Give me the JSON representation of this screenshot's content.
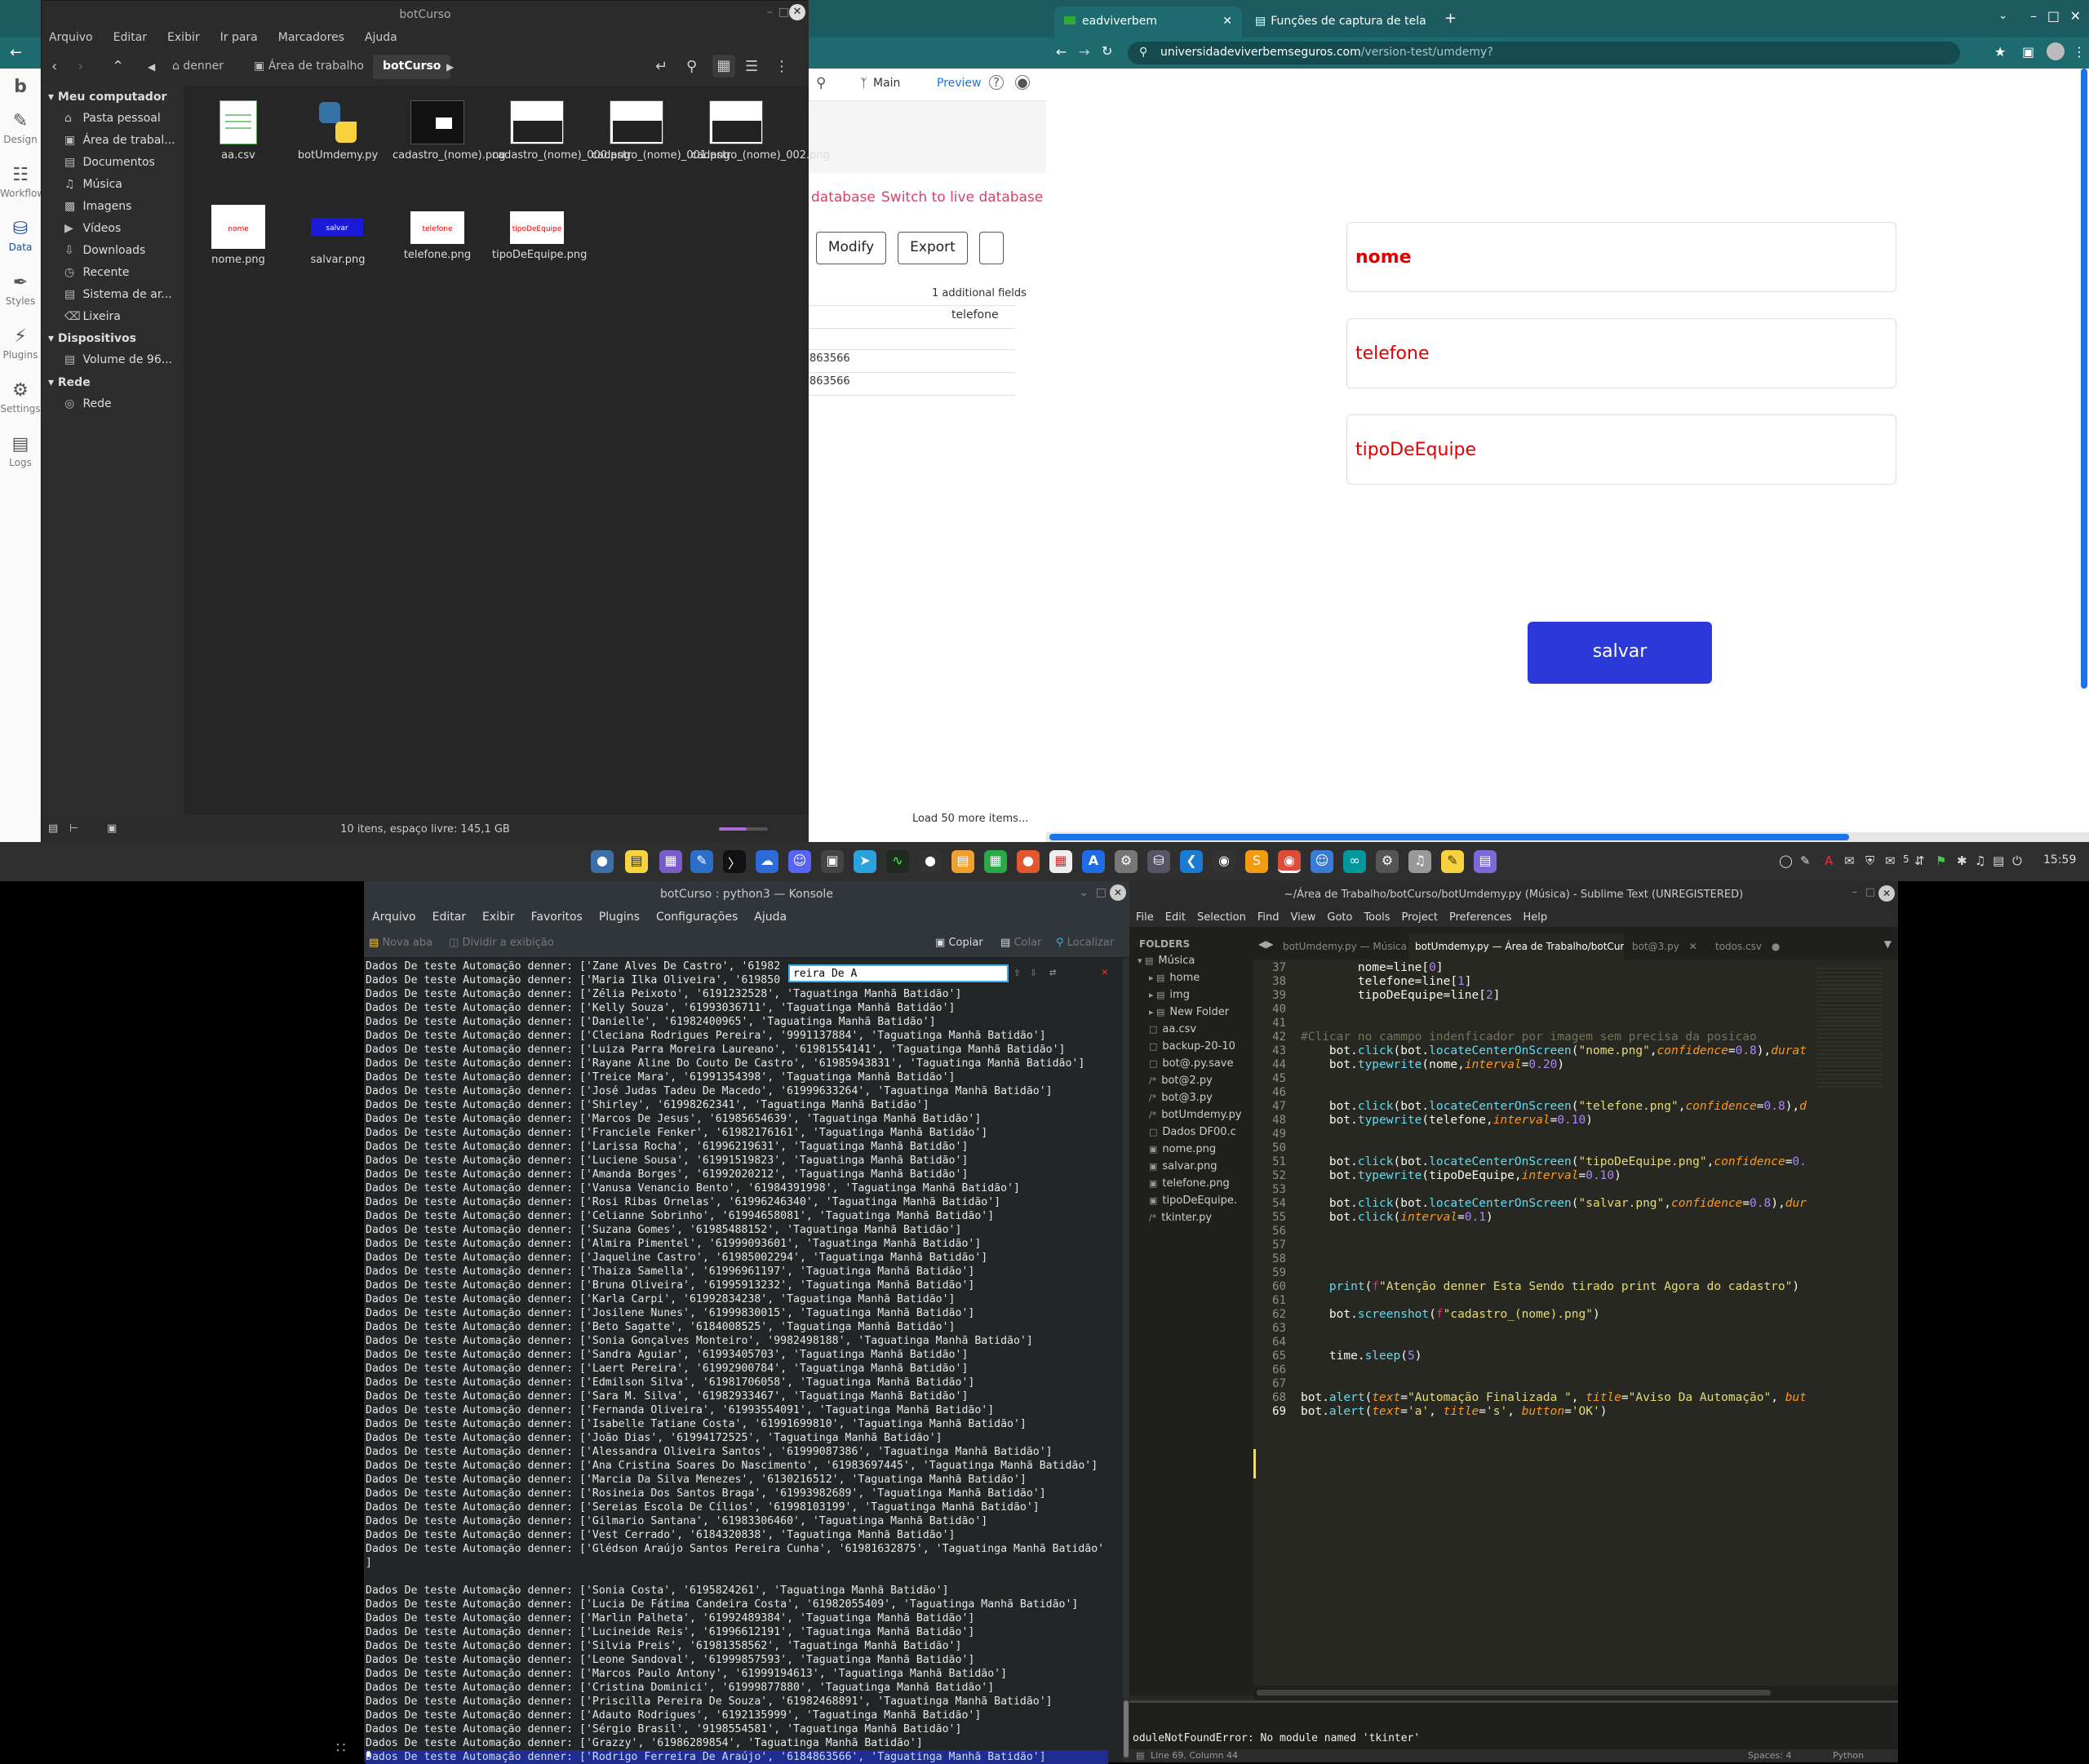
{
  "bg_chrome": {
    "strip": [
      {
        "label": "Design",
        "icon": "pencil-ruler-icon"
      },
      {
        "label": "Workflow",
        "icon": "workflow-icon"
      },
      {
        "label": "Data",
        "icon": "database-icon"
      },
      {
        "label": "Styles",
        "icon": "brush-icon"
      },
      {
        "label": "Plugins",
        "icon": "plug-icon"
      },
      {
        "label": "Settings",
        "icon": "gear-icon"
      },
      {
        "label": "Logs",
        "icon": "document-icon"
      }
    ],
    "main_tab": "Main",
    "preview": "Preview",
    "link_database": "database",
    "link_live": "Switch to live database",
    "btn_modify": "Modify",
    "btn_export": "Export",
    "additional_fields": "1 additional fields",
    "col_telefone": "telefone",
    "row1": "863566",
    "row2": "863566",
    "load_more": "Load 50 more items..."
  },
  "filemgr": {
    "title": "botCurso",
    "menu": [
      "Arquivo",
      "Editar",
      "Exibir",
      "Ir para",
      "Marcadores",
      "Ajuda"
    ],
    "crumbs": [
      "denner",
      "Área de trabalho",
      "botCurso"
    ],
    "sidebar": {
      "computer_head": "Meu computador",
      "computer": [
        "Pasta pessoal",
        "Área de trabal...",
        "Documentos",
        "Música",
        "Imagens",
        "Vídeos",
        "Downloads",
        "Recente",
        "Sistema de ar...",
        "Lixeira"
      ],
      "devices_head": "Dispositivos",
      "devices": [
        "Volume de 96..."
      ],
      "network_head": "Rede",
      "network": [
        "Rede"
      ]
    },
    "files": [
      {
        "name": "aa.csv"
      },
      {
        "name": "botUmdemy.py"
      },
      {
        "name": "cadastro_(nome).png"
      },
      {
        "name": "cadastro_(nome)_000.png"
      },
      {
        "name": "cadastro_(nome)_001.png"
      },
      {
        "name": "cadastro_(nome)_002.png"
      },
      {
        "name": "nome.png"
      },
      {
        "name": "salvar.png"
      },
      {
        "name": "telefone.png"
      },
      {
        "name": "tipoDeEquipe.png"
      }
    ],
    "thumb_text": {
      "nome": "nome",
      "salvar": "salvar",
      "telefone": "telefone",
      "tipo": "tipoDeEquipe"
    },
    "status": "10 itens, espaço livre: 145,1 GB"
  },
  "chrome": {
    "tabs": [
      "eadviverbem",
      "Funções de captura de tela"
    ],
    "url_host": "universidadeviverbemseguros.com",
    "url_path": "/version-test/umdemy?",
    "fields": [
      "nome",
      "telefone",
      "tipoDeEquipe"
    ],
    "save": "salvar"
  },
  "taskbar": {
    "clock": "15:59",
    "badge": "5"
  },
  "konsole": {
    "title": "botCurso : python3 — Konsole",
    "menu": [
      "Arquivo",
      "Editar",
      "Exibir",
      "Favoritos",
      "Plugins",
      "Configurações",
      "Ajuda"
    ],
    "toolbar_left": "Nova aba",
    "toolbar_split": "Dividir a exibição",
    "toolbar_copy": "Copiar",
    "toolbar_paste": "Colar",
    "toolbar_find": "Localizar",
    "search": "reira De A",
    "lines": [
      "Dados De teste Automação denner: ['Zane Alves De Castro', '61982",
      "Dados De teste Automação denner: ['Maria Ilka Oliveira', '619850",
      "Dados De teste Automação denner: ['Zélia Peixoto', '6191232528', 'Taguatinga Manhã Batidão']",
      "Dados De teste Automação denner: ['Kelly Souza', '61993036711', 'Taguatinga Manhã Batidão']",
      "Dados De teste Automação denner: ['Danielle', '61982400965', 'Taguatinga Manhã Batidão']",
      "Dados De teste Automação denner: ['Cleciana Rodrigues Pereira', '9991137884', 'Taguatinga Manhã Batidão']",
      "Dados De teste Automação denner: ['Luiza Parra Moreira Laureano', '61981554141', 'Taguatinga Manhã Batidão']",
      "Dados De teste Automação denner: ['Rayane Aline Do Couto De Castro', '61985943831', 'Taguatinga Manhã Batidão']",
      "Dados De teste Automação denner: ['Treice Mara', '61991354398', 'Taguatinga Manhã Batidão']",
      "Dados De teste Automação denner: ['José Judas Tadeu De Macedo', '61999633264', 'Taguatinga Manhã Batidão']",
      "Dados De teste Automação denner: ['Shirley', '61998262341', 'Taguatinga Manhã Batidão']",
      "Dados De teste Automação denner: ['Marcos De Jesus', '61985654639', 'Taguatinga Manhã Batidão']",
      "Dados De teste Automação denner: ['Franciele Fenker', '61982176161', 'Taguatinga Manhã Batidão']",
      "Dados De teste Automação denner: ['Larissa Rocha', '61996219631', 'Taguatinga Manhã Batidão']",
      "Dados De teste Automação denner: ['Luciene Sousa', '61991519823', 'Taguatinga Manhã Batidão']",
      "Dados De teste Automação denner: ['Amanda Borges', '61992020212', 'Taguatinga Manhã Batidão']",
      "Dados De teste Automação denner: ['Vanusa Venancio Bento', '61984391998', 'Taguatinga Manhã Batidão']",
      "Dados De teste Automação denner: ['Rosi Ribas Ornelas', '61996246340', 'Taguatinga Manhã Batidão']",
      "Dados De teste Automação denner: ['Celianne Sobrinho', '61994658081', 'Taguatinga Manhã Batidão']",
      "Dados De teste Automação denner: ['Suzana Gomes', '61985488152', 'Taguatinga Manhã Batidão']",
      "Dados De teste Automação denner: ['Almira Pimentel', '61999093601', 'Taguatinga Manhã Batidão']",
      "Dados De teste Automação denner: ['Jaqueline Castro', '61985002294', 'Taguatinga Manhã Batidão']",
      "Dados De teste Automação denner: ['Thaiza Samella', '61996961197', 'Taguatinga Manhã Batidão']",
      "Dados De teste Automação denner: ['Bruna Oliveira', '61995913232', 'Taguatinga Manhã Batidão']",
      "Dados De teste Automação denner: ['Karla Carpi', '61992834238', 'Taguatinga Manhã Batidão']",
      "Dados De teste Automação denner: ['Josilene Nunes', '61999830015', 'Taguatinga Manhã Batidão']",
      "Dados De teste Automação denner: ['Beto Sagatte', '6184008525', 'Taguatinga Manhã Batidão']",
      "Dados De teste Automação denner: ['Sonia Gonçalves Monteiro', '9982498188', 'Taguatinga Manhã Batidão']",
      "Dados De teste Automação denner: ['Sandra Aguiar', '61993405703', 'Taguatinga Manhã Batidão']",
      "Dados De teste Automação denner: ['Laert Pereira', '61992900784', 'Taguatinga Manhã Batidão']",
      "Dados De teste Automação denner: ['Edmilson Silva', '61981706058', 'Taguatinga Manhã Batidão']",
      "Dados De teste Automação denner: ['Sara M. Silva', '61982933467', 'Taguatinga Manhã Batidão']",
      "Dados De teste Automação denner: ['Fernanda Oliveira', '61993554091', 'Taguatinga Manhã Batidão']",
      "Dados De teste Automação denner: ['Isabelle Tatiane Costa', '61991699810', 'Taguatinga Manhã Batidão']",
      "Dados De teste Automação denner: ['João Dias', '61994172525', 'Taguatinga Manhã Batidão']",
      "Dados De teste Automação denner: ['Alessandra Oliveira Santos', '61999087386', 'Taguatinga Manhã Batidão']",
      "Dados De teste Automação denner: ['Ana Cristina Soares Do Nascimento', '61983697445', 'Taguatinga Manhã Batidão']",
      "Dados De teste Automação denner: ['Marcia Da Silva Menezes', '6130216512', 'Taguatinga Manhã Batidão']",
      "Dados De teste Automação denner: ['Rosineia Dos Santos Braga', '61993982689', 'Taguatinga Manhã Batidão']",
      "Dados De teste Automação denner: ['Sereias Escola De Cílios', '61998103199', 'Taguatinga Manhã Batidão']",
      "Dados De teste Automação denner: ['Gilmario Santana', '61983306460', 'Taguatinga Manhã Batidão']",
      "Dados De teste Automação denner: ['Vest Cerrado', '6184320838', 'Taguatinga Manhã Batidão']",
      "Dados De teste Automação denner: ['Glédson Araújo Santos Pereira Cunha', '61981632875', 'Taguatinga Manhã Batidão'",
      "]",
      "",
      "Dados De teste Automação denner: ['Sonia Costa', '6195824261', 'Taguatinga Manhã Batidão']",
      "Dados De teste Automação denner: ['Lucia De Fátima Candeira Costa', '61982055409', 'Taguatinga Manhã Batidão']",
      "Dados De teste Automação denner: ['Marlin Palheta', '61992489384', 'Taguatinga Manhã Batidão']",
      "Dados De teste Automação denner: ['Lucineide Reis', '61996612191', 'Taguatinga Manhã Batidão']",
      "Dados De teste Automação denner: ['Silvia Preis', '61981358562', 'Taguatinga Manhã Batidão']",
      "Dados De teste Automação denner: ['Leone Sandoval', '61999857593', 'Taguatinga Manhã Batidão']",
      "Dados De teste Automação denner: ['Marcos Paulo Antony', '61999194613', 'Taguatinga Manhã Batidão']",
      "Dados De teste Automação denner: ['Cristina Dominici', '61999877880', 'Taguatinga Manhã Batidão']",
      "Dados De teste Automação denner: ['Priscilla Pereira De Souza', '61982468891', 'Taguatinga Manhã Batidão']",
      "Dados De teste Automação denner: ['Adauto Rodrigues', '6192135999', 'Taguatinga Manhã Batidão']",
      "Dados De teste Automação denner: ['Sérgio Brasil', '9198554581', 'Taguatinga Manhã Batidão']",
      "Dados De teste Automação denner: ['Grazzy', '61986289854', 'Taguatinga Manhã Batidão']",
      "Dados De teste Automação denner: ['Rodrigo Ferreira De Araújo', '6184863566', 'Taguatinga Manhã Batidão']"
    ]
  },
  "sublime": {
    "title": "~/Área de Trabalho/botCurso/botUmdemy.py (Música) - Sublime Text (UNREGISTERED)",
    "menu": [
      "File",
      "Edit",
      "Selection",
      "Find",
      "View",
      "Goto",
      "Tools",
      "Project",
      "Preferences",
      "Help"
    ],
    "folders_label": "FOLDERS",
    "sidebar": [
      "Música",
      "home",
      "img",
      "New Folder",
      "aa.csv",
      "backup-20-10",
      "bot@.py.save",
      "bot@2.py",
      "bot@3.py",
      "botUmdemy.py",
      "Dados DF00.c",
      "nome.png",
      "salvar.png",
      "telefone.png",
      "tipoDeEquipe.",
      "tkinter.py"
    ],
    "tabs": [
      "botUmdemy.py — Música",
      "botUmdemy.py — Área de Trabalho/botCurso",
      "bot@3.py",
      "todos.csv"
    ],
    "gutter": [
      "37",
      "38",
      "39",
      "40",
      "41",
      "42",
      "43",
      "44",
      "45",
      "46",
      "47",
      "48",
      "49",
      "50",
      "51",
      "52",
      "53",
      "54",
      "55",
      "56",
      "57",
      "58",
      "59",
      "60",
      "61",
      "62",
      "63",
      "64",
      "65",
      "66",
      "67",
      "68",
      "69"
    ],
    "console": "oduleNotFoundError: No module named 'tkinter'",
    "status_left": "Line 69, Column 44",
    "status_spaces": "Spaces: 4",
    "status_lang": "Python"
  }
}
